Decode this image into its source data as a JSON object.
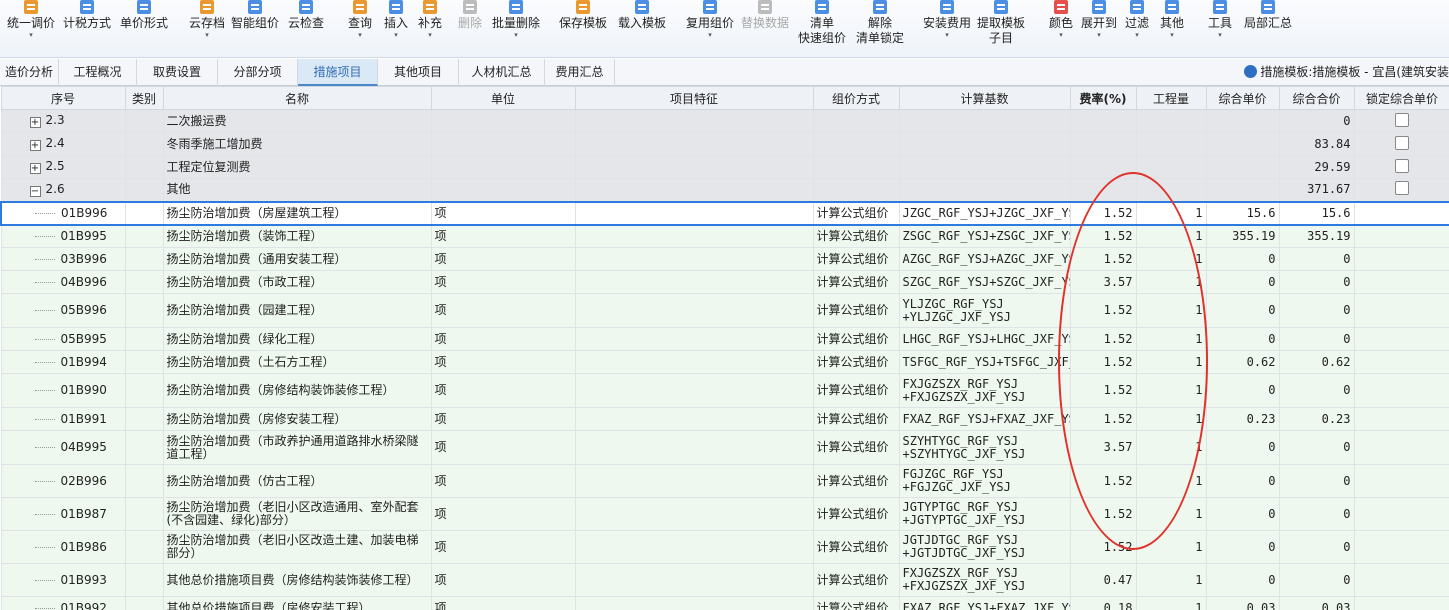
{
  "toolbar": {
    "buttons": [
      {
        "label": "统一调价",
        "caret": "▾",
        "icon": "adjust-price-icon",
        "color": "#e8860c"
      },
      {
        "label": "计税方式",
        "icon": "tax-method-icon",
        "color": "#2d7be0"
      },
      {
        "label": "单价形式",
        "icon": "unit-price-form-icon",
        "color": "#2d7be0"
      },
      {
        "label": "云存档",
        "caret": "▾",
        "icon": "cloud-save-icon",
        "color": "#e8860c"
      },
      {
        "label": "智能组价",
        "icon": "smart-pricing-icon",
        "color": "#2d7be0"
      },
      {
        "label": "云检查",
        "icon": "cloud-check-icon",
        "color": "#2d7be0"
      },
      {
        "label": "查询",
        "caret": "▾",
        "icon": "query-icon",
        "color": "#e8860c"
      },
      {
        "label": "插入",
        "caret": "▾",
        "icon": "insert-icon",
        "color": "#2d7be0"
      },
      {
        "label": "补充",
        "caret": "▾",
        "icon": "supplement-icon",
        "color": "#e8860c"
      },
      {
        "label": "删除",
        "icon": "delete-icon",
        "disabled": true,
        "color": "#b0b0b0"
      },
      {
        "label": "批量删除",
        "caret": "▾",
        "icon": "batch-delete-icon",
        "color": "#2d7be0"
      },
      {
        "label": "保存模板",
        "icon": "save-template-icon",
        "color": "#e8860c"
      },
      {
        "label": "载入模板",
        "icon": "load-template-icon",
        "color": "#2d7be0"
      },
      {
        "label": "复用组价",
        "caret": "▾",
        "icon": "reuse-pricing-icon",
        "color": "#2d7be0"
      },
      {
        "label": "替换数据",
        "icon": "replace-data-icon",
        "disabled": true,
        "color": "#b0b0b0"
      },
      {
        "label": "清单",
        "label2": "快速组价",
        "icon": "quick-pricing-icon",
        "color": "#2d7be0"
      },
      {
        "label": "解除",
        "label2": "清单锁定",
        "icon": "unlock-list-icon",
        "color": "#2d7be0"
      },
      {
        "label": "安装费用",
        "caret": "▾",
        "icon": "install-fee-icon",
        "color": "#2d7be0"
      },
      {
        "label": "提取模板",
        "label2": "子目",
        "icon": "extract-template-icon",
        "color": "#2d7be0"
      },
      {
        "label": "颜色",
        "caret": "▾",
        "icon": "color-icon",
        "color": "#e0312b"
      },
      {
        "label": "展开到",
        "caret": "▾",
        "icon": "expand-to-icon",
        "color": "#2d7be0"
      },
      {
        "label": "过滤",
        "caret": "▾",
        "icon": "filter-icon",
        "color": "#2d7be0"
      },
      {
        "label": "其他",
        "caret": "▾",
        "icon": "other-icon",
        "color": "#2d7be0"
      },
      {
        "label": "工具",
        "caret": "▾",
        "icon": "tools-icon",
        "color": "#2d7be0"
      },
      {
        "label": "局部汇总",
        "icon": "partial-summary-icon",
        "color": "#2d7be0"
      }
    ]
  },
  "tabs": [
    "造价分析",
    "工程概况",
    "取费设置",
    "分部分项",
    "措施项目",
    "其他项目",
    "人材机汇总",
    "费用汇总"
  ],
  "active_tab": 4,
  "template_info": "措施模板:措施模板 - 宜昌(建筑安装",
  "columns": [
    "序号",
    "类别",
    "名称",
    "单位",
    "项目特征",
    "组价方式",
    "计算基数",
    "费率(%)",
    "工程量",
    "综合单价",
    "综合合价",
    "锁定综合单价"
  ],
  "rows": [
    {
      "type": "section",
      "expander": "+",
      "seq": "2.3",
      "name": "二次搬运费",
      "total": "0"
    },
    {
      "type": "section",
      "expander": "+",
      "seq": "2.4",
      "name": "冬雨季施工增加费",
      "total": "83.84"
    },
    {
      "type": "section",
      "expander": "+",
      "seq": "2.5",
      "name": "工程定位复测费",
      "total": "29.59"
    },
    {
      "type": "section",
      "expander": "−",
      "seq": "2.6",
      "name": "其他",
      "total": "371.67"
    },
    {
      "type": "item",
      "selected": true,
      "seq": "01B996",
      "name": "扬尘防治增加费（房屋建筑工程）",
      "unit": "项",
      "method": "计算公式组价",
      "base": "JZGC_RGF_YSJ+JZGC_JXF_YSJ",
      "rate": "1.52",
      "qty": "1",
      "price": "15.6",
      "total": "15.6"
    },
    {
      "type": "item",
      "seq": "01B995",
      "name": "扬尘防治增加费（装饰工程）",
      "unit": "项",
      "method": "计算公式组价",
      "base": "ZSGC_RGF_YSJ+ZSGC_JXF_YSJ",
      "rate": "1.52",
      "qty": "1",
      "price": "355.19",
      "total": "355.19"
    },
    {
      "type": "item",
      "seq": "03B996",
      "name": "扬尘防治增加费（通用安装工程）",
      "unit": "项",
      "method": "计算公式组价",
      "base": "AZGC_RGF_YSJ+AZGC_JXF_YSJ",
      "rate": "1.52",
      "qty": "1",
      "price": "0",
      "total": "0"
    },
    {
      "type": "item",
      "seq": "04B996",
      "name": "扬尘防治增加费（市政工程）",
      "unit": "项",
      "method": "计算公式组价",
      "base": "SZGC_RGF_YSJ+SZGC_JXF_YSJ",
      "rate": "3.57",
      "qty": "1",
      "price": "0",
      "total": "0"
    },
    {
      "type": "item",
      "seq": "05B996",
      "name": "扬尘防治增加费（园建工程）",
      "unit": "项",
      "method": "计算公式组价",
      "base": "YLJZGC_RGF_YSJ",
      "base2": "+YLJZGC_JXF_YSJ",
      "rate": "1.52",
      "qty": "1",
      "price": "0",
      "total": "0"
    },
    {
      "type": "item",
      "seq": "05B995",
      "name": "扬尘防治增加费（绿化工程）",
      "unit": "项",
      "method": "计算公式组价",
      "base": "LHGC_RGF_YSJ+LHGC_JXF_YSJ",
      "rate": "1.52",
      "qty": "1",
      "price": "0",
      "total": "0"
    },
    {
      "type": "item",
      "seq": "01B994",
      "name": "扬尘防治增加费（土石方工程）",
      "unit": "项",
      "method": "计算公式组价",
      "base": "TSFGC_RGF_YSJ+TSFGC_JXF_YSJ",
      "rate": "1.52",
      "qty": "1",
      "price": "0.62",
      "total": "0.62"
    },
    {
      "type": "item",
      "seq": "01B990",
      "name": "扬尘防治增加费（房修结构装饰装修工程）",
      "unit": "项",
      "method": "计算公式组价",
      "base": "FXJGZSZX_RGF_YSJ",
      "base2": "+FXJGZSZX_JXF_YSJ",
      "rate": "1.52",
      "qty": "1",
      "price": "0",
      "total": "0"
    },
    {
      "type": "item",
      "seq": "01B991",
      "name": "扬尘防治增加费（房修安装工程）",
      "unit": "项",
      "method": "计算公式组价",
      "base": "FXAZ_RGF_YSJ+FXAZ_JXF_YSJ",
      "rate": "1.52",
      "qty": "1",
      "price": "0.23",
      "total": "0.23"
    },
    {
      "type": "item",
      "seq": "04B995",
      "name": "扬尘防治增加费（市政养护通用道路排水桥梁隧道工程）",
      "unit": "项",
      "method": "计算公式组价",
      "base": "SZYHTYGC_RGF_YSJ",
      "base2": "+SZYHTYGC_JXF_YSJ",
      "rate": "3.57",
      "qty": "1",
      "price": "0",
      "total": "0"
    },
    {
      "type": "item",
      "seq": "02B996",
      "name": "扬尘防治增加费（仿古工程）",
      "unit": "项",
      "method": "计算公式组价",
      "base": "FGJZGC_RGF_YSJ",
      "base2": "+FGJZGC_JXF_YSJ",
      "rate": "1.52",
      "qty": "1",
      "price": "0",
      "total": "0"
    },
    {
      "type": "item",
      "seq": "01B987",
      "name": "扬尘防治增加费（老旧小区改造通用、室外配套(不含园建、绿化)部分）",
      "unit": "项",
      "method": "计算公式组价",
      "base": "JGTYPTGC_RGF_YSJ",
      "base2": "+JGTYPTGC_JXF_YSJ",
      "rate": "1.52",
      "qty": "1",
      "price": "0",
      "total": "0"
    },
    {
      "type": "item",
      "seq": "01B986",
      "name": "扬尘防治增加费（老旧小区改造土建、加装电梯部分）",
      "unit": "项",
      "method": "计算公式组价",
      "base": "JGTJDTGC_RGF_YSJ",
      "base2": "+JGTJDTGC_JXF_YSJ",
      "rate": "1.52",
      "qty": "1",
      "price": "0",
      "total": "0"
    },
    {
      "type": "item",
      "seq": "01B993",
      "name": "其他总价措施项目费（房修结构装饰装修工程）",
      "unit": "项",
      "method": "计算公式组价",
      "base": "FXJGZSZX_RGF_YSJ",
      "base2": "+FXJGZSZX_JXF_YSJ",
      "rate": "0.47",
      "qty": "1",
      "price": "0",
      "total": "0"
    },
    {
      "type": "item",
      "seq": "01B992",
      "name": "其他总价措施项目费（房修安装工程）",
      "unit": "项",
      "method": "计算公式组价",
      "base": "FXAZ_RGF_YSJ+FXAZ_JXF_YSJ",
      "rate": "0.18",
      "qty": "1",
      "price": "0.03",
      "total": "0.03"
    }
  ]
}
